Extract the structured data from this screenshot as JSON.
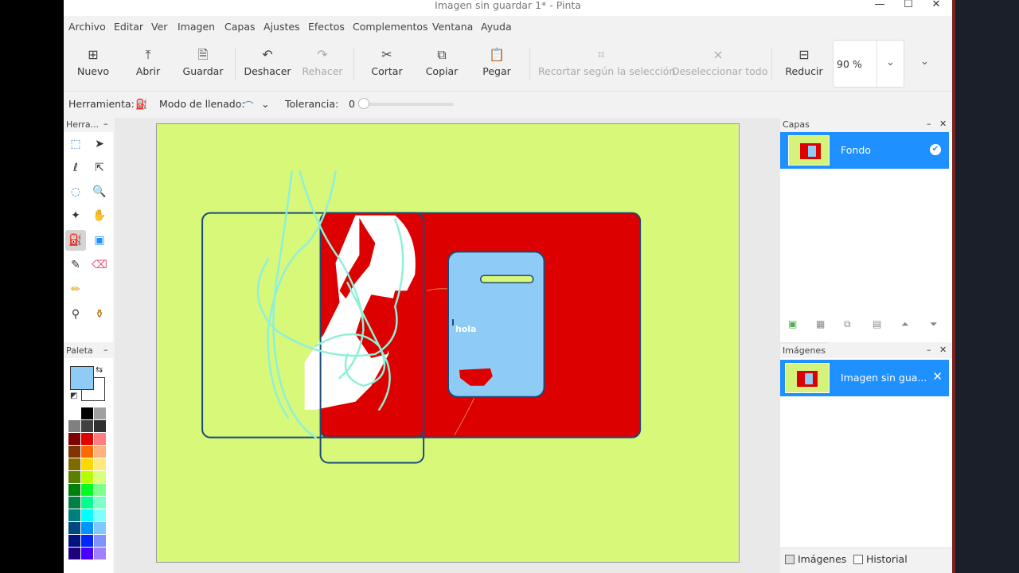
{
  "window": {
    "title": "Imagen sin guardar 1* - Pinta"
  },
  "menu": [
    "Archivo",
    "Editar",
    "Ver",
    "Imagen",
    "Capas",
    "Ajustes",
    "Efectos",
    "Complementos",
    "Ventana",
    "Ayuda"
  ],
  "toolbar": {
    "nuevo": "Nuevo",
    "abrir": "Abrir",
    "guardar": "Guardar",
    "deshacer": "Deshacer",
    "rehacer": "Rehacer",
    "cortar": "Cortar",
    "copiar": "Copiar",
    "pegar": "Pegar",
    "recortar": "Recortar según la selección",
    "deseleccionar": "Deseleccionar todo",
    "reducir": "Reducir",
    "zoom": "90 %"
  },
  "options": {
    "tool_label": "Herramienta:",
    "fill_label": "Modo de llenado:",
    "tolerance_label": "Tolerancia:",
    "tolerance_value": "0"
  },
  "tools_panel": {
    "title": "Herra..."
  },
  "palette_panel": {
    "title": "Paleta"
  },
  "layers_panel": {
    "title": "Capas",
    "layers": [
      {
        "name": "Fondo",
        "visible": true
      }
    ]
  },
  "images_panel": {
    "title": "Imágenes",
    "images": [
      {
        "name": "Imagen sin gua..."
      }
    ]
  },
  "tabs": {
    "images": "Imágenes",
    "history": "Historial"
  },
  "canvas": {
    "text": "hola"
  },
  "colors": {
    "primary": "#8ecbf5",
    "secondary": "#ffffff",
    "canvas_bg": "#d8f87a",
    "red": "#dd0000",
    "selection": "#1e90ff"
  }
}
